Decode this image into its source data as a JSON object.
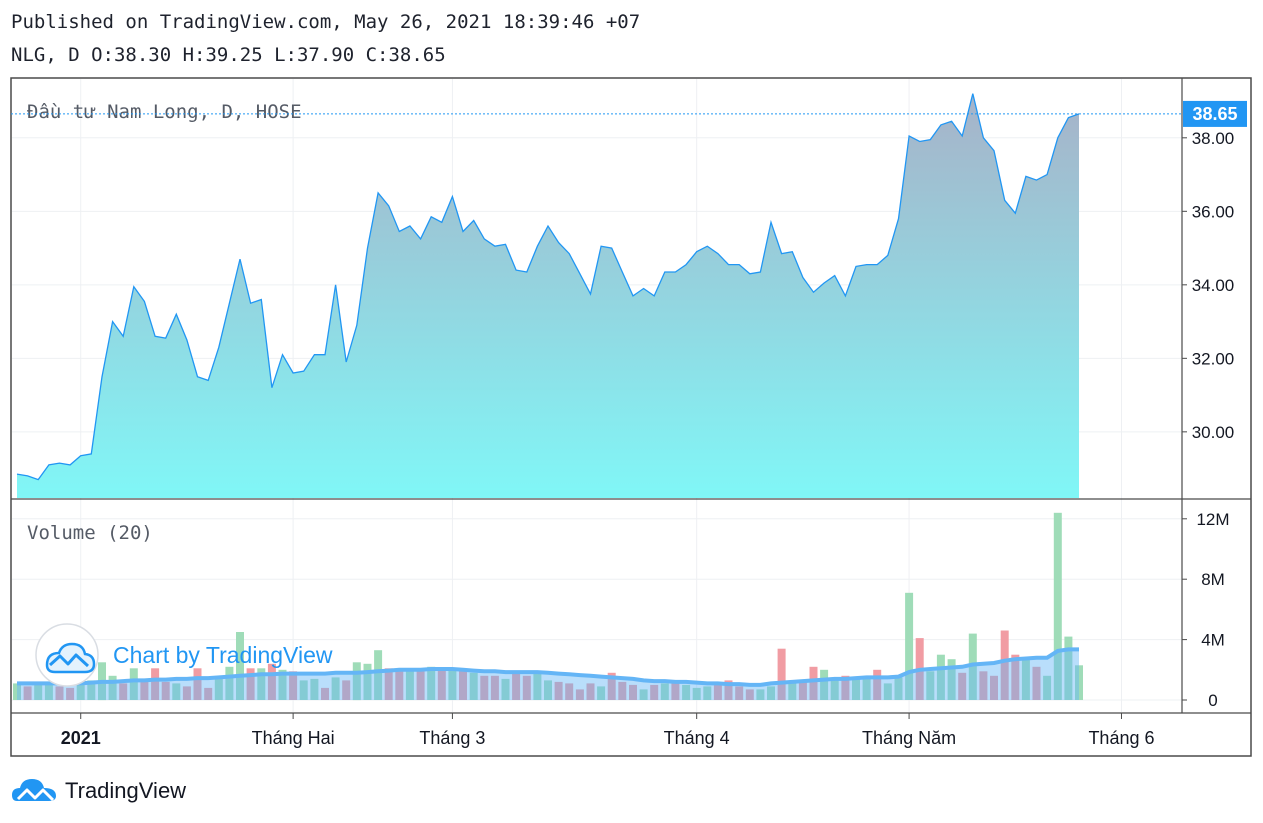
{
  "header": {
    "published": "Published on TradingView.com, May 26, 2021 18:39:46 +07",
    "ohlc": "NLG, D O:38.30 H:39.25 L:37.90 C:38.65"
  },
  "footer": {
    "brand": "TradingView"
  },
  "watermark": "Chart by TradingView",
  "colors": {
    "line": "#2196f3",
    "area_top": "#a7b2c8",
    "area_bottom": "#80f7f7",
    "vol_up": "#9fdcb8",
    "vol_down": "#f19ca3",
    "vol_ma": "#64b5f6",
    "price_label_bg": "#2196f3"
  },
  "chart_data": [
    {
      "type": "area",
      "title": "Đầu tư Nam Long, D, HOSE",
      "last_price_label": "38.65",
      "y_ticks": [
        "30.00",
        "32.00",
        "34.00",
        "36.00",
        "38.00"
      ],
      "y_tick_values": [
        30,
        32,
        34,
        36,
        38
      ],
      "ylim": [
        28.2,
        39.6
      ],
      "x_ticks": [
        {
          "label": "2021",
          "index": 6,
          "bold": true
        },
        {
          "label": "Tháng Hai",
          "index": 26,
          "bold": false
        },
        {
          "label": "Tháng 3",
          "index": 41,
          "bold": false
        },
        {
          "label": "Tháng 4",
          "index": 64,
          "bold": false
        },
        {
          "label": "Tháng Năm",
          "index": 84,
          "bold": false
        },
        {
          "label": "Tháng 6",
          "index": 104,
          "bold": false
        }
      ],
      "values": [
        28.85,
        28.8,
        28.7,
        29.1,
        29.15,
        29.1,
        29.35,
        29.4,
        31.5,
        33.0,
        32.6,
        33.95,
        33.55,
        32.6,
        32.55,
        33.2,
        32.5,
        31.5,
        31.4,
        32.3,
        33.5,
        34.7,
        33.5,
        33.6,
        31.2,
        32.1,
        31.6,
        31.65,
        32.1,
        32.1,
        34.0,
        31.9,
        32.9,
        35.0,
        36.5,
        36.15,
        35.45,
        35.6,
        35.25,
        35.85,
        35.7,
        36.4,
        35.45,
        35.75,
        35.25,
        35.05,
        35.1,
        34.4,
        34.35,
        35.05,
        35.6,
        35.15,
        34.85,
        34.3,
        33.75,
        35.05,
        35.0,
        34.35,
        33.7,
        33.9,
        33.7,
        34.35,
        34.35,
        34.55,
        34.9,
        35.05,
        34.85,
        34.55,
        34.55,
        34.3,
        34.35,
        35.7,
        34.85,
        34.9,
        34.2,
        33.8,
        34.05,
        34.25,
        33.7,
        34.5,
        34.55,
        34.55,
        34.8,
        35.8,
        38.05,
        37.9,
        37.95,
        38.35,
        38.45,
        38.05,
        39.2,
        38.0,
        37.65,
        36.3,
        35.95,
        36.95,
        36.85,
        37.0,
        38.0,
        38.55,
        38.65
      ]
    },
    {
      "type": "bar",
      "title": "Volume (20)",
      "y_ticks": [
        "0",
        "4M",
        "8M",
        "12M"
      ],
      "y_tick_values": [
        0,
        4,
        8,
        12
      ],
      "unit": "M",
      "ylim": [
        0,
        12.8
      ],
      "values": [
        1.1,
        0.9,
        1.0,
        1.1,
        0.9,
        0.8,
        1.2,
        1.3,
        2.5,
        1.6,
        1.1,
        2.1,
        1.2,
        2.1,
        1.2,
        1.1,
        0.9,
        2.1,
        0.8,
        1.5,
        2.2,
        4.5,
        2.1,
        2.1,
        2.4,
        2.0,
        1.9,
        1.3,
        1.4,
        0.8,
        1.5,
        1.3,
        2.5,
        2.4,
        3.3,
        2.1,
        1.9,
        2.0,
        1.9,
        2.2,
        2.0,
        2.1,
        1.9,
        1.8,
        1.6,
        1.6,
        1.4,
        1.8,
        1.6,
        1.8,
        1.3,
        1.2,
        1.1,
        0.7,
        1.1,
        0.9,
        1.8,
        1.2,
        1.0,
        0.7,
        1.0,
        1.1,
        1.3,
        1.0,
        0.8,
        0.9,
        1.1,
        1.3,
        0.9,
        0.7,
        0.7,
        0.9,
        3.4,
        1.1,
        1.3,
        2.2,
        2.0,
        1.5,
        1.6,
        1.5,
        1.5,
        2.0,
        1.1,
        1.5,
        7.1,
        4.1,
        1.9,
        3.0,
        2.7,
        1.8,
        4.4,
        1.9,
        1.6,
        4.6,
        3.0,
        2.7,
        2.2,
        1.6,
        12.4,
        4.2,
        2.3
      ],
      "direction": [
        "u",
        "d",
        "u",
        "u",
        "d",
        "d",
        "u",
        "u",
        "u",
        "u",
        "d",
        "u",
        "d",
        "d",
        "d",
        "u",
        "d",
        "d",
        "d",
        "u",
        "u",
        "u",
        "d",
        "u",
        "d",
        "u",
        "d",
        "u",
        "u",
        "d",
        "u",
        "d",
        "u",
        "u",
        "u",
        "d",
        "d",
        "u",
        "d",
        "u",
        "d",
        "u",
        "d",
        "u",
        "d",
        "d",
        "u",
        "d",
        "d",
        "u",
        "u",
        "d",
        "d",
        "d",
        "d",
        "u",
        "d",
        "d",
        "d",
        "u",
        "d",
        "u",
        "d",
        "u",
        "u",
        "u",
        "d",
        "d",
        "d",
        "d",
        "u",
        "u",
        "d",
        "u",
        "d",
        "d",
        "u",
        "u",
        "d",
        "u",
        "u",
        "d",
        "u",
        "u",
        "u",
        "d",
        "u",
        "u",
        "u",
        "d",
        "u",
        "d",
        "d",
        "d",
        "d",
        "u",
        "d",
        "u",
        "u",
        "u",
        "u"
      ],
      "ma_values": [
        1.1,
        1.1,
        1.1,
        1.1,
        1.1,
        1.1,
        1.1,
        1.15,
        1.2,
        1.2,
        1.25,
        1.3,
        1.3,
        1.35,
        1.35,
        1.4,
        1.4,
        1.45,
        1.45,
        1.5,
        1.55,
        1.6,
        1.65,
        1.7,
        1.7,
        1.75,
        1.75,
        1.75,
        1.75,
        1.75,
        1.8,
        1.8,
        1.8,
        1.85,
        1.9,
        1.95,
        2.0,
        2.0,
        2.0,
        2.05,
        2.05,
        2.05,
        2.0,
        1.95,
        1.9,
        1.9,
        1.85,
        1.85,
        1.85,
        1.85,
        1.8,
        1.75,
        1.7,
        1.65,
        1.6,
        1.55,
        1.5,
        1.45,
        1.4,
        1.3,
        1.25,
        1.25,
        1.2,
        1.2,
        1.15,
        1.1,
        1.1,
        1.05,
        1.05,
        1.0,
        1.0,
        1.1,
        1.15,
        1.2,
        1.25,
        1.3,
        1.35,
        1.4,
        1.4,
        1.45,
        1.5,
        1.5,
        1.5,
        1.55,
        1.85,
        2.0,
        2.05,
        2.1,
        2.15,
        2.2,
        2.35,
        2.4,
        2.45,
        2.6,
        2.7,
        2.75,
        2.8,
        2.8,
        3.25,
        3.35,
        3.35
      ]
    }
  ]
}
